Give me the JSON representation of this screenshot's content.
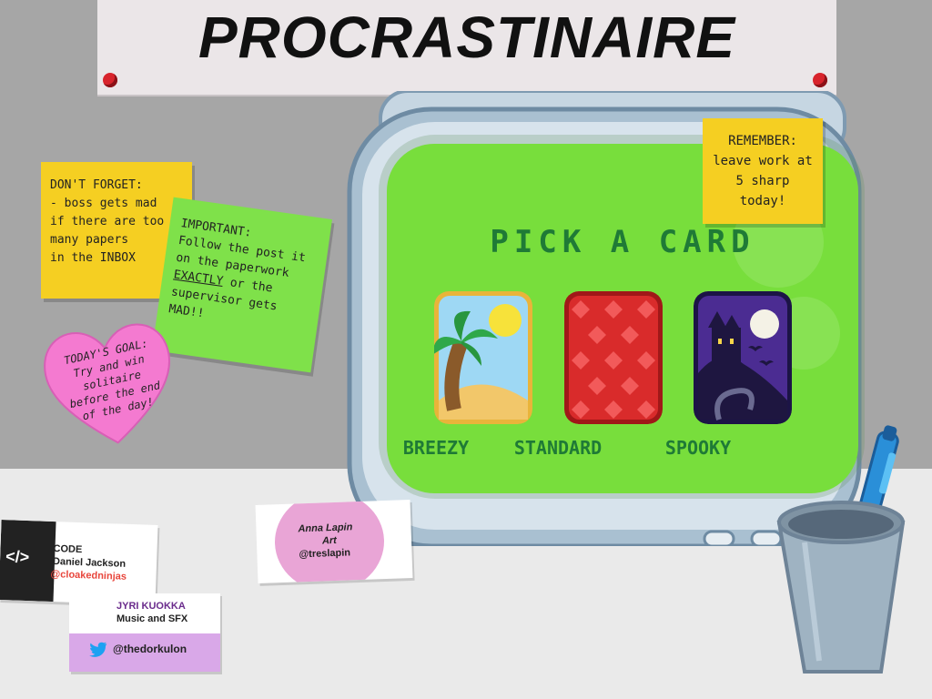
{
  "banner": {
    "title": "PROCRASTINAIRE"
  },
  "notes": {
    "dont_forget": {
      "lines": [
        "DON'T FORGET:",
        "- boss gets mad",
        "if there are too",
        "many papers",
        "in the INBOX"
      ]
    },
    "important": {
      "line1": "IMPORTANT:",
      "line2": "Follow the post it",
      "line3": "on the paperwork",
      "line4a": "EXACTLY",
      "line4b": " or the",
      "line5": "supervisor gets",
      "line6": "MAD!!"
    },
    "remember": {
      "lines": [
        "REMEMBER:",
        "leave work at",
        "5 sharp",
        "today!"
      ]
    },
    "goal": {
      "lines": [
        "TODAY'S GOAL:",
        "Try and win",
        "solitaire",
        "before the end",
        "of the day!"
      ]
    }
  },
  "screen": {
    "title": "PICK A CARD",
    "cards": [
      {
        "label": "BREEZY",
        "icon": "palm-island-icon"
      },
      {
        "label": "STANDARD",
        "icon": "diamond-pattern-icon"
      },
      {
        "label": "SPOOKY",
        "icon": "haunted-castle-icon"
      }
    ]
  },
  "credits": {
    "code": {
      "role": "CODE",
      "name": "Daniel Jackson",
      "handle": "@cloakedninjas",
      "icon": "</>"
    },
    "art": {
      "name": "Anna Lapin",
      "role": "Art",
      "handle": "@treslapin"
    },
    "music": {
      "name": "JYRI KUOKKA",
      "role": "Music and SFX",
      "handle": "@thedorkulon",
      "icon": "twitter-bird-icon"
    }
  },
  "colors": {
    "screen": "#78de3c",
    "screen_text": "#1f7a36",
    "sticky_yellow": "#f5cf22",
    "sticky_green": "#7fe14a",
    "heart_pink": "#f47ad0",
    "handle_red": "#e8463c",
    "jyri_purple": "#6a2b8c"
  }
}
